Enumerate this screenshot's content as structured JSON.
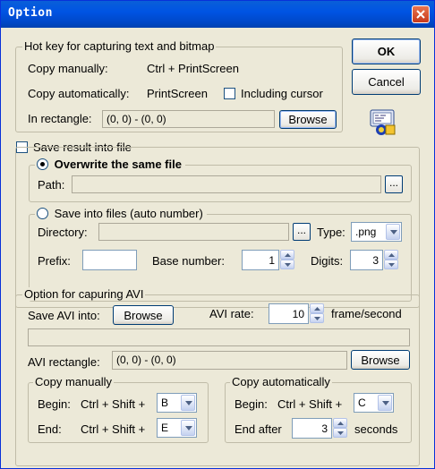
{
  "window": {
    "title": "Option"
  },
  "hotkey": {
    "group_caption": "Hot key for capturing text and bitmap",
    "copy_manually_label": "Copy manually:",
    "copy_manually_value": "Ctrl + PrintScreen",
    "copy_auto_label": "Copy automatically:",
    "copy_auto_value": "PrintScreen",
    "including_cursor_label": "Including cursor",
    "including_cursor_checked": false,
    "in_rect_label": "In rectangle:",
    "in_rect_value": "(0, 0) - (0, 0)",
    "browse_label": "Browse"
  },
  "dialog_buttons": {
    "ok": "OK",
    "cancel": "Cancel"
  },
  "save": {
    "save_result_label": "Save result into file",
    "save_result_checked": false,
    "overwrite_label": "Overwrite the same file",
    "overwrite_selected": true,
    "path_label": "Path:",
    "path_value": "",
    "ellipsis": "...",
    "auto_label": "Save into files (auto number)",
    "directory_label": "Directory:",
    "directory_value": "",
    "type_label": "Type:",
    "type_value": ".png",
    "prefix_label": "Prefix:",
    "prefix_value": "",
    "base_number_label": "Base number:",
    "base_number_value": "1",
    "digits_label": "Digits:",
    "digits_value": "3"
  },
  "avi": {
    "group_caption": "Option for capuring AVI",
    "save_into_label": "Save AVI into:",
    "browse_label": "Browse",
    "rate_label": "AVI rate:",
    "rate_value": "10",
    "rate_unit": "frame/second",
    "path_value": "",
    "rect_label": "AVI rectangle:",
    "rect_value": "(0, 0) - (0, 0)",
    "rect_browse_label": "Browse",
    "manual": {
      "caption": "Copy manually",
      "begin_label": "Begin:",
      "begin_mod": "Ctrl + Shift +",
      "begin_key": "B",
      "end_label": "End:",
      "end_mod": "Ctrl + Shift +",
      "end_key": "E"
    },
    "auto": {
      "caption": "Copy automatically",
      "begin_label": "Begin:",
      "begin_mod": "Ctrl + Shift +",
      "begin_key": "C",
      "end_label": "End after",
      "end_value": "3",
      "end_unit": "seconds"
    }
  }
}
